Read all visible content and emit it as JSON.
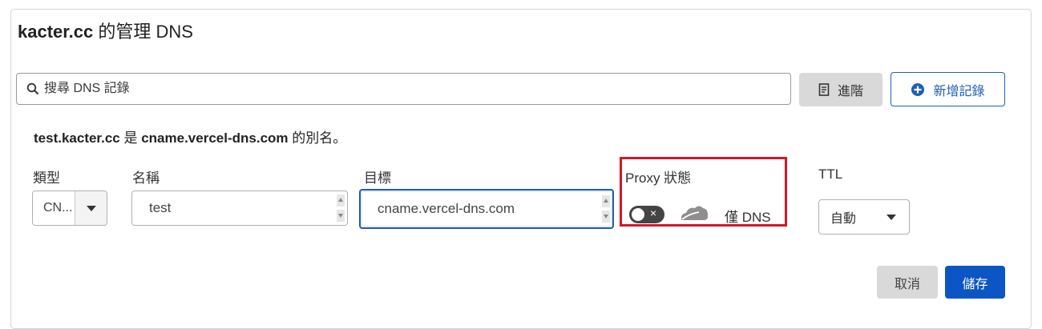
{
  "dialog": {
    "domain": "kacter.cc",
    "title_suffix": "的管理 DNS"
  },
  "toolbar": {
    "search_placeholder": "搜尋 DNS 記錄",
    "advanced_label": "進階",
    "add_record_label": "新增記錄"
  },
  "alias_notice": {
    "name": "test.kacter.cc",
    "is_text": "是",
    "target": "cname.vercel-dns.com",
    "suffix": "的別名。"
  },
  "form": {
    "type_label": "類型",
    "type_value": "CN...",
    "name_label": "名稱",
    "name_value": "test",
    "target_label": "目標",
    "target_value": "cname.vercel-dns.com",
    "proxy_label": "Proxy 狀態",
    "proxy_status_text": "僅 DNS",
    "proxy_enabled": false,
    "ttl_label": "TTL",
    "ttl_value": "自動"
  },
  "actions": {
    "cancel_label": "取消",
    "save_label": "儲存"
  },
  "colors": {
    "accent": "#1f5fb0",
    "primary_button": "#0b55c4",
    "highlight_border": "#d4162b"
  }
}
